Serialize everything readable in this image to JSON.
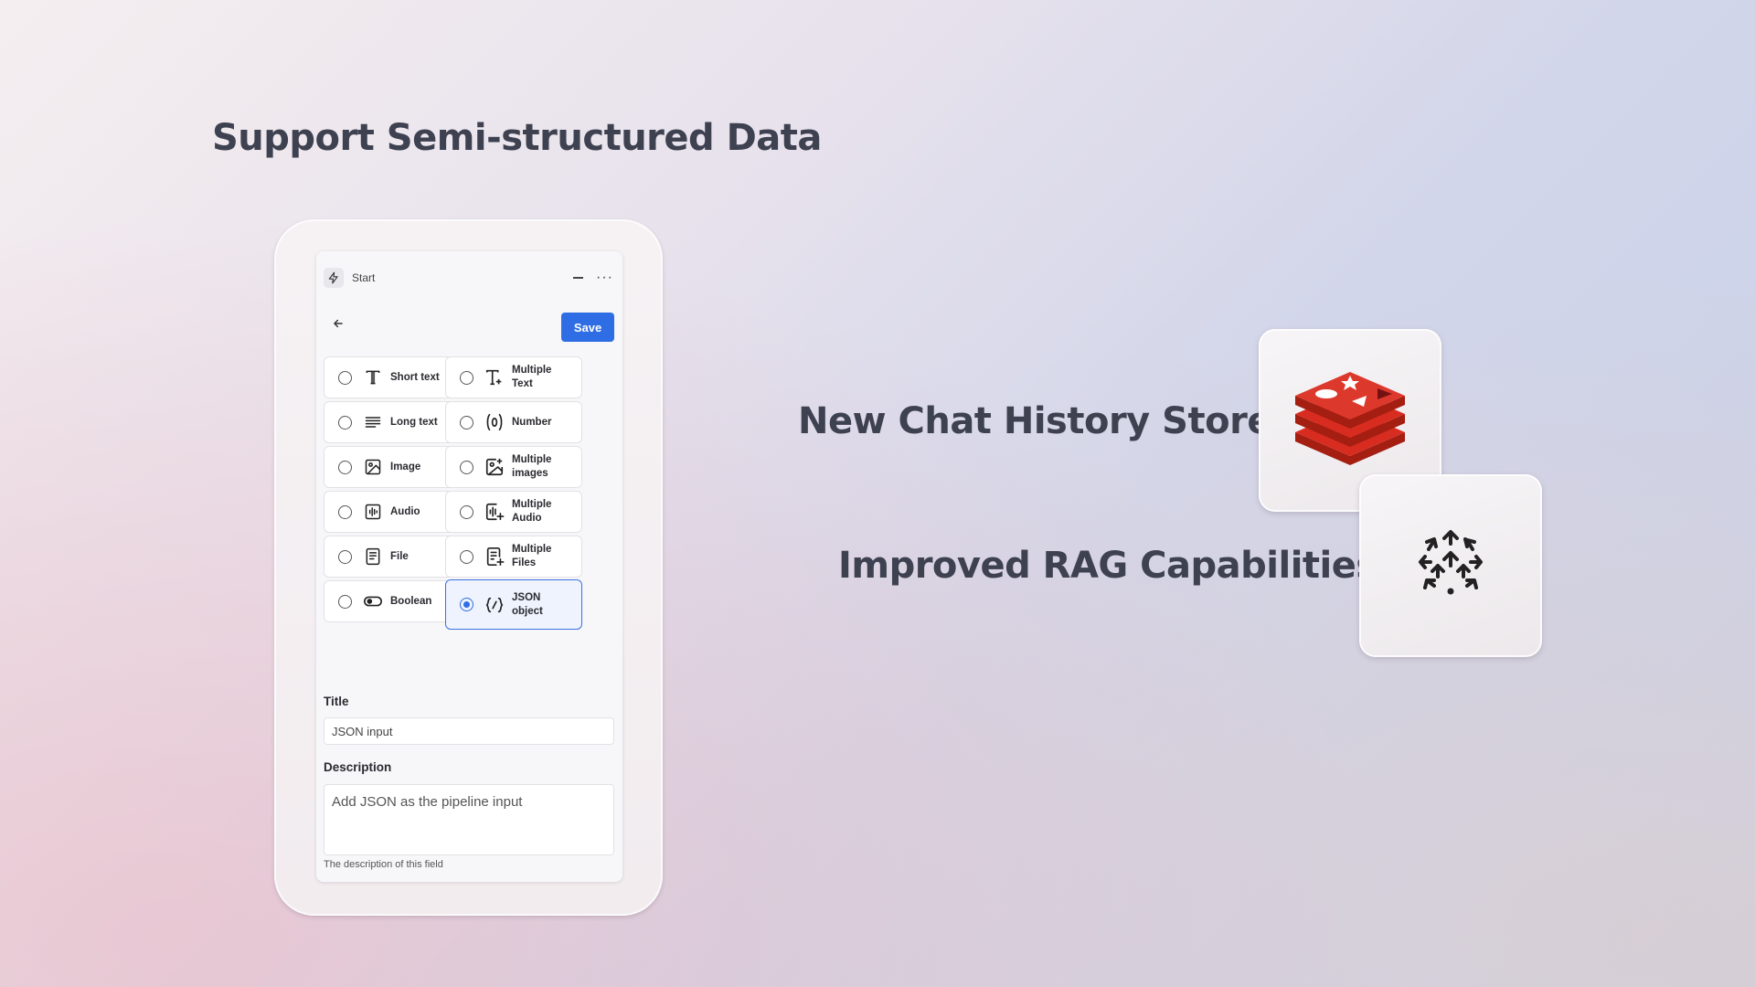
{
  "headlines": {
    "semi": "Support Semi-structured Data",
    "chat": "New Chat History Store",
    "rag": "Improved RAG Capabilities"
  },
  "panel": {
    "header_label": "Start",
    "save_label": "Save",
    "options": [
      {
        "label": "Short text",
        "icon": "short-text-icon"
      },
      {
        "label": "Multiple Text",
        "icon": "multiple-text-icon"
      },
      {
        "label": "Long text",
        "icon": "long-text-icon"
      },
      {
        "label": "Number",
        "icon": "number-icon"
      },
      {
        "label": "Image",
        "icon": "image-icon"
      },
      {
        "label": "Multiple images",
        "icon": "multiple-images-icon"
      },
      {
        "label": "Audio",
        "icon": "audio-icon"
      },
      {
        "label": "Multiple Audio",
        "icon": "multiple-audio-icon"
      },
      {
        "label": "File",
        "icon": "file-icon"
      },
      {
        "label": "Multiple Files",
        "icon": "multiple-files-icon"
      },
      {
        "label": "Boolean",
        "icon": "toggle-icon"
      },
      {
        "label": "JSON object",
        "icon": "json-icon",
        "selected": true
      }
    ],
    "title_label": "Title",
    "title_value": "JSON input",
    "description_label": "Description",
    "description_value": "Add JSON as the pipeline input",
    "description_help": "The description of this field"
  },
  "colors": {
    "accent": "#2e6de3",
    "headline": "#3e4150",
    "redis_red": "#d82c20"
  },
  "icons": {
    "redis_card": "redis-logo-icon",
    "rag_card": "rag-network-icon"
  }
}
